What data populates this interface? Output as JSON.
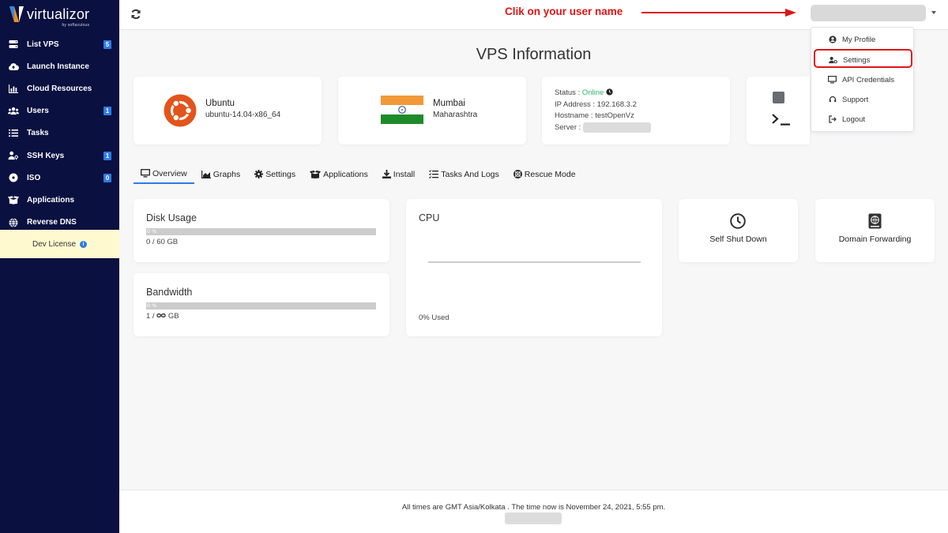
{
  "brand": {
    "name": "virtualizor",
    "sub": "by softaculous"
  },
  "sidebar": {
    "items": [
      {
        "label": "List VPS",
        "icon": "server-icon",
        "badge": "5"
      },
      {
        "label": "Launch Instance",
        "icon": "cloud-upload-icon",
        "badge": ""
      },
      {
        "label": "Cloud Resources",
        "icon": "bar-chart-icon",
        "badge": ""
      },
      {
        "label": "Users",
        "icon": "users-icon",
        "badge": "1"
      },
      {
        "label": "Tasks",
        "icon": "list-icon",
        "badge": ""
      },
      {
        "label": "SSH Keys",
        "icon": "user-key-icon",
        "badge": "1"
      },
      {
        "label": "ISO",
        "icon": "disc-icon",
        "badge": "0"
      },
      {
        "label": "Applications",
        "icon": "box-icon",
        "badge": ""
      },
      {
        "label": "Reverse DNS",
        "icon": "globe-icon",
        "badge": ""
      }
    ],
    "dev_license": "Dev License"
  },
  "topbar": {
    "annotation": "Clik on your user name"
  },
  "user_menu": {
    "items": [
      {
        "label": "My Profile",
        "icon": "user-circle-icon"
      },
      {
        "label": "Settings",
        "icon": "user-gear-icon"
      },
      {
        "label": "API Credentials",
        "icon": "monitor-icon"
      },
      {
        "label": "Support",
        "icon": "headset-icon"
      },
      {
        "label": "Logout",
        "icon": "logout-icon"
      }
    ]
  },
  "page_title": "VPS Information",
  "os_card": {
    "name": "Ubuntu",
    "template": "ubuntu-14.04-x86_64"
  },
  "location_card": {
    "city": "Mumbai",
    "region": "Maharashtra"
  },
  "status_card": {
    "status_label": "Status :",
    "status_value": "Online",
    "ip_label": "IP Address :",
    "ip_value": "192.168.3.2",
    "hostname_label": "Hostname :",
    "hostname_value": "testOpenVz",
    "server_label": "Server :"
  },
  "tabs": [
    {
      "label": "Overview",
      "icon": "monitor-icon"
    },
    {
      "label": "Graphs",
      "icon": "area-chart-icon"
    },
    {
      "label": "Settings",
      "icon": "gear-icon"
    },
    {
      "label": "Applications",
      "icon": "boxes-icon"
    },
    {
      "label": "Install",
      "icon": "download-icon"
    },
    {
      "label": "Tasks And Logs",
      "icon": "checklist-icon"
    },
    {
      "label": "Rescue Mode",
      "icon": "lifering-icon"
    }
  ],
  "disk": {
    "title": "Disk Usage",
    "percent_text": "0 %",
    "usage": "0 / 60 GB"
  },
  "bandwidth": {
    "title": "Bandwidth",
    "percent_text": "0 %",
    "usage_prefix": "1 /",
    "usage_suffix": "GB"
  },
  "cpu": {
    "title": "CPU",
    "used": "0% Used"
  },
  "tiles": {
    "shutdown": "Self Shut Down",
    "forwarding": "Domain Forwarding"
  },
  "footer": {
    "text": "All times are GMT Asia/Kolkata . The time now is November 24, 2021, 5:55 pm."
  },
  "colors": {
    "sidebar": "#0a1040",
    "accent": "#2e7be6",
    "online": "#2cb36b",
    "annotation": "#e01515",
    "license_bg": "#fff9cf"
  }
}
